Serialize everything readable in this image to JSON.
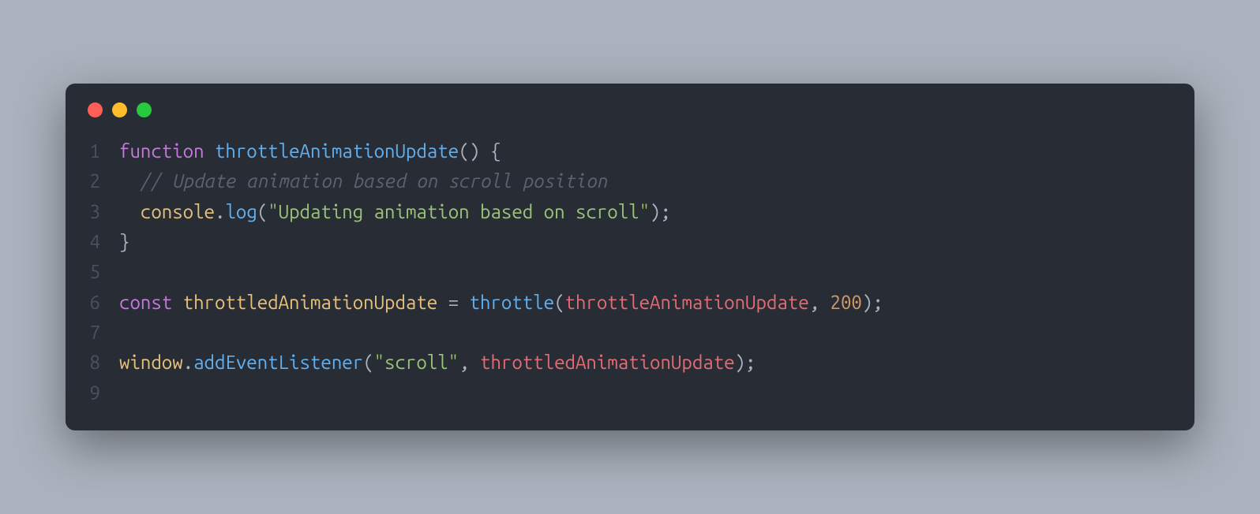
{
  "window": {
    "traffic_lights": [
      "red",
      "yellow",
      "green"
    ]
  },
  "colors": {
    "bg_page": "#aab2bd",
    "bg_window": "#282c34",
    "dot_red": "#ff5f56",
    "dot_yellow": "#ffbd2e",
    "dot_green": "#27c93f",
    "gutter": "#495162",
    "default": "#abb2bf",
    "keyword": "#c678dd",
    "funcname": "#61afef",
    "comment": "#5c6370",
    "property": "#e5c07b",
    "string": "#98c379",
    "variable": "#e06c75",
    "number": "#d19a66"
  },
  "line_numbers": [
    "1",
    "2",
    "3",
    "4",
    "5",
    "6",
    "7",
    "8",
    "9"
  ],
  "code": {
    "lines": [
      {
        "tokens": [
          {
            "t": "function",
            "c": "keyword"
          },
          {
            "t": " ",
            "c": "default"
          },
          {
            "t": "throttleAnimationUpdate",
            "c": "funcname"
          },
          {
            "t": "() {",
            "c": "default"
          }
        ]
      },
      {
        "tokens": [
          {
            "t": "  ",
            "c": "default"
          },
          {
            "t": "// Update animation based on scroll position",
            "c": "comment"
          }
        ]
      },
      {
        "tokens": [
          {
            "t": "  ",
            "c": "default"
          },
          {
            "t": "console",
            "c": "property"
          },
          {
            "t": ".",
            "c": "default"
          },
          {
            "t": "log",
            "c": "funcname"
          },
          {
            "t": "(",
            "c": "default"
          },
          {
            "t": "\"Updating animation based on scroll\"",
            "c": "string"
          },
          {
            "t": ");",
            "c": "default"
          }
        ]
      },
      {
        "tokens": [
          {
            "t": "}",
            "c": "default"
          }
        ]
      },
      {
        "tokens": []
      },
      {
        "tokens": [
          {
            "t": "const",
            "c": "keyword"
          },
          {
            "t": " ",
            "c": "default"
          },
          {
            "t": "throttledAnimationUpdate",
            "c": "property"
          },
          {
            "t": " = ",
            "c": "default"
          },
          {
            "t": "throttle",
            "c": "funcname"
          },
          {
            "t": "(",
            "c": "default"
          },
          {
            "t": "throttleAnimationUpdate",
            "c": "variable"
          },
          {
            "t": ", ",
            "c": "default"
          },
          {
            "t": "200",
            "c": "number"
          },
          {
            "t": ");",
            "c": "default"
          }
        ]
      },
      {
        "tokens": []
      },
      {
        "tokens": [
          {
            "t": "window",
            "c": "property"
          },
          {
            "t": ".",
            "c": "default"
          },
          {
            "t": "addEventListener",
            "c": "funcname"
          },
          {
            "t": "(",
            "c": "default"
          },
          {
            "t": "\"scroll\"",
            "c": "string"
          },
          {
            "t": ", ",
            "c": "default"
          },
          {
            "t": "throttledAnimationUpdate",
            "c": "variable"
          },
          {
            "t": ");",
            "c": "default"
          }
        ]
      },
      {
        "tokens": []
      }
    ]
  }
}
